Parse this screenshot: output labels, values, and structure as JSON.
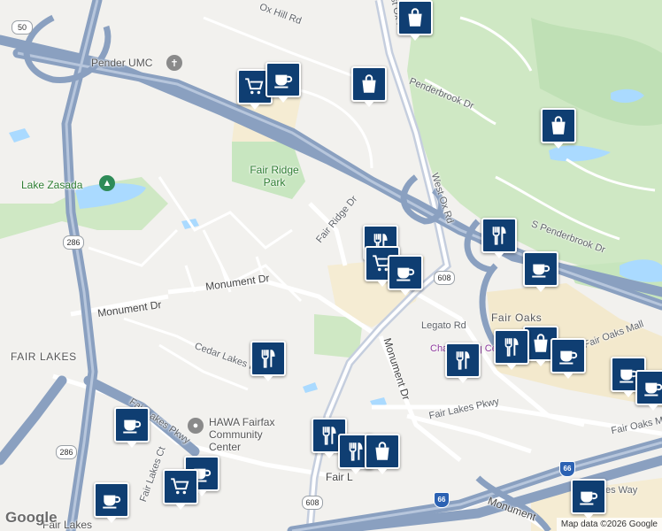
{
  "map": {
    "labels": {
      "ox_hill_rd": "Ox Hill Rd",
      "west_ox_rd_top": "West Ox Rd",
      "pender_umc": "Pender UMC",
      "penderbrook_dr": "Penderbrook Dr",
      "fair_ridge_park": "Fair Ridge Park",
      "lake_zasada": "Lake Zasada",
      "fair_ridge_dr": "Fair Ridge Dr",
      "west_ox_rd": "West Ox Rd",
      "s_penderbrook_dr": "S Penderbrook Dr",
      "monument_dr_upper": "Monument Dr",
      "monument_dr_left": "Monument Dr",
      "legato_rd": "Legato Rd",
      "fair_oaks_area": "Fair Oaks",
      "fair_oaks_mall_partial": "Fair Oaks Mall",
      "fair_lakes_area": "FAIR LAKES",
      "cedar_lakes_dr": "Cedar Lakes Dr",
      "monument_dr_diag": "Monument Dr",
      "chantilly_partial": "Chantilly Sq Center",
      "hawa_center": "HAWA Fairfax Community Center",
      "fair_lakes_pkwy_left": "Fair Lakes Pkwy",
      "fair_lakes_pkwy_right": "Fair Lakes Pkwy",
      "fair_oaks_mall": "Fair Oaks Mall",
      "fair_lakes_ct": "Fair Lakes Ct",
      "fair_lakes_partial": "Fair L",
      "monument_bottom": "Monument",
      "fair_lakes_bottom": "Fair Lakes",
      "es_way": "es Way"
    },
    "shields": {
      "us50": "50",
      "va286_a": "286",
      "va286_b": "286",
      "va608_a": "608",
      "va608_b": "608",
      "i66": "66",
      "i66_b": "66"
    },
    "colors": {
      "water": "#aadaff",
      "park": "#c8e6c0",
      "highway": "#8aa0c0",
      "commercial": "#f5ecd3",
      "marker": "#0f3e72"
    },
    "markers": [
      {
        "type": "shopping"
      },
      {
        "type": "grocery"
      },
      {
        "type": "cafe"
      },
      {
        "type": "shopping"
      },
      {
        "type": "shopping"
      },
      {
        "type": "restaurant"
      },
      {
        "type": "grocery"
      },
      {
        "type": "cafe"
      },
      {
        "type": "restaurant"
      },
      {
        "type": "cafe"
      },
      {
        "type": "restaurant"
      },
      {
        "type": "shopping"
      },
      {
        "type": "cafe"
      },
      {
        "type": "restaurant"
      },
      {
        "type": "restaurant"
      },
      {
        "type": "cafe"
      },
      {
        "type": "cafe"
      },
      {
        "type": "cafe"
      },
      {
        "type": "restaurant"
      },
      {
        "type": "restaurant"
      },
      {
        "type": "shopping"
      },
      {
        "type": "cafe"
      },
      {
        "type": "grocery"
      },
      {
        "type": "cafe"
      },
      {
        "type": "cafe"
      }
    ]
  },
  "footer": {
    "logo": "Google",
    "attribution": "Map data ©2026 Google"
  }
}
